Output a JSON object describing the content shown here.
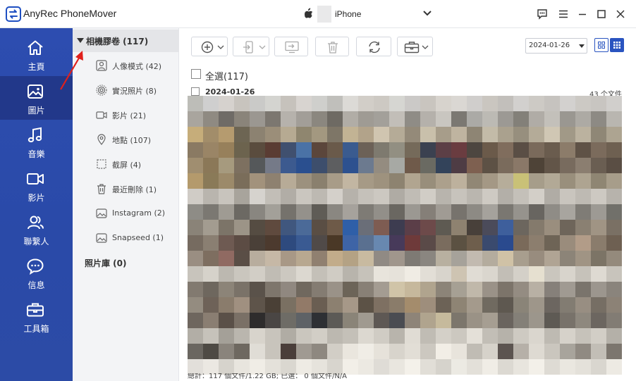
{
  "app": {
    "title": "AnyRec PhoneMover"
  },
  "device": {
    "name": "iPhone"
  },
  "nav": {
    "items": [
      {
        "label": "主頁",
        "icon": "home-icon"
      },
      {
        "label": "圖片",
        "icon": "image-icon",
        "active": true
      },
      {
        "label": "音樂",
        "icon": "music-icon"
      },
      {
        "label": "影片",
        "icon": "video-icon"
      },
      {
        "label": "聯繫人",
        "icon": "contacts-icon"
      },
      {
        "label": "信息",
        "icon": "message-icon"
      },
      {
        "label": "工具箱",
        "icon": "toolbox-icon"
      }
    ]
  },
  "albums": {
    "header": "相機膠卷 (117)",
    "items": [
      {
        "label": "人像模式 (42)",
        "icon": "portrait-icon"
      },
      {
        "label": "實況照片 (8)",
        "icon": "live-photo-icon"
      },
      {
        "label": "影片 (21)",
        "icon": "video-icon"
      },
      {
        "label": "地點 (107)",
        "icon": "location-icon"
      },
      {
        "label": "截屏 (4)",
        "icon": "screenshot-icon"
      },
      {
        "label": "最近刪除 (1)",
        "icon": "trash-icon"
      },
      {
        "label": "Instagram (2)",
        "icon": "album-icon"
      },
      {
        "label": "Snapseed (1)",
        "icon": "album-icon"
      }
    ],
    "library": "照片庫 (0)"
  },
  "toolbar": {
    "buttons": [
      "add-button",
      "export-device-button",
      "export-pc-button",
      "delete-button",
      "sync-button",
      "toolbox-button"
    ]
  },
  "filter": {
    "date": "2024-01-26"
  },
  "content": {
    "select_all": "全選(117)",
    "group_date": "2024-01-26",
    "group_count": "43 个文件",
    "thumbnail_colors": [
      "#bdbdb8",
      "#cfcfcf",
      "#d6d2ce",
      "#c8c4be",
      "#cacac8",
      "#d4d4d0",
      "#c6c2bc",
      "#d8d4d0",
      "#cfcfcc",
      "#c0bfbb",
      "#dcdad6",
      "#d2cec8",
      "#cdc9c3",
      "#d6d6d2",
      "#cbc9c7",
      "#c9c5bf",
      "#d7d3cd",
      "#dad7d3",
      "#d0cecc",
      "#cac6c0",
      "#c2bfbb",
      "#d2d0ce",
      "#cdcac5",
      "#c6c3bf",
      "#d3d1cf",
      "#ccc9c4",
      "#c8c5c1",
      "#d1cfcc",
      "#a9a59e",
      "#8f8a82",
      "#6f6b66",
      "#8a847a",
      "#9b9791",
      "#7c7770",
      "#b6b2ac",
      "#a29e98",
      "#8b877f",
      "#6e6a63",
      "#b1ada6",
      "#9f9b94",
      "#a3a09a",
      "#c2beb8",
      "#8f8c86",
      "#b5b1ab",
      "#c9c6c0",
      "#7b7872",
      "#abaaa6",
      "#bcbab4",
      "#9c9994",
      "#838079",
      "#b0aca6",
      "#c3c0ba",
      "#9a9791",
      "#adaaa4",
      "#8d8a84",
      "#b9b6b0",
      "#c6ad7a",
      "#a28d6a",
      "#b59b6f",
      "#6d6553",
      "#8c8271",
      "#9b8e79",
      "#b6aa92",
      "#8f866f",
      "#a39880",
      "#7e7667",
      "#c2b394",
      "#b2a38a",
      "#d0c5b0",
      "#b5ab97",
      "#948a79",
      "#c9c0ab",
      "#a79d8a",
      "#bfb4a0",
      "#8e8574",
      "#c3bba8",
      "#aaa18e",
      "#978f7e",
      "#b4ab98",
      "#d0c7b4",
      "#a19987",
      "#bbb29f",
      "#8f8776",
      "#ada491",
      "#8a7a63",
      "#9a8566",
      "#97805b",
      "#6c634e",
      "#5a4c3e",
      "#5a3c33",
      "#40506f",
      "#4a72a6",
      "#5b463b",
      "#6a5a4a",
      "#3a5b8f",
      "#6c6157",
      "#7e7a6f",
      "#928f82",
      "#756a5a",
      "#3b4150",
      "#5c3f46",
      "#6a3c40",
      "#4d4640",
      "#6b5a4a",
      "#806d5d",
      "#5a4e45",
      "#7a6a5b",
      "#6a5c4e",
      "#8c7c6a",
      "#5f5246",
      "#7b6b5c",
      "#6e6051",
      "#a08e70",
      "#8b7858",
      "#a69a7e",
      "#7d7060",
      "#55585a",
      "#757a88",
      "#3c5a8f",
      "#2a4f8f",
      "#3d4e6c",
      "#5d5e60",
      "#2d518f",
      "#6c7a8f",
      "#948c80",
      "#a7a9a4",
      "#6f5a4a",
      "#6a6a62",
      "#33435a",
      "#4e3c44",
      "#7e6050",
      "#5d5145",
      "#7a6b5c",
      "#8a7868",
      "#4e4337",
      "#625548",
      "#786b5e",
      "#8b7e70",
      "#6a5e52",
      "#5a4e44",
      "#b49a6c",
      "#8a7a58",
      "#9c8a6a",
      "#7a6d5a",
      "#a2927c",
      "#8e8170",
      "#b7ab97",
      "#9c917e",
      "#8a806e",
      "#a89c88",
      "#c2b6a2",
      "#a69a86",
      "#9e927e",
      "#8d8370",
      "#b1a590",
      "#988e7b",
      "#aca08c",
      "#bdb19d",
      "#918775",
      "#a49885",
      "#b6ad9a",
      "#c9c177",
      "#a69d8a",
      "#b2a996",
      "#998f7c",
      "#aea491",
      "#8f8673",
      "#a79d8a",
      "#d0ccc6",
      "#b9b5ae",
      "#c8c4bd",
      "#a8a49c",
      "#d6d3ce",
      "#c2beb7",
      "#b1ada6",
      "#cac6bf",
      "#bdb9b2",
      "#d4d0ca",
      "#b6b2ab",
      "#c5c1ba",
      "#ccc8c1",
      "#afaba4",
      "#c0bcb5",
      "#d1cdc6",
      "#b8b4ad",
      "#c7c3bc",
      "#bab6af",
      "#cecac3",
      "#b3afa8",
      "#c4c0b9",
      "#d3cfc8",
      "#b0aca5",
      "#c9c5be",
      "#bebab3",
      "#cdc9c2",
      "#b7b3ac",
      "#8e8c86",
      "#7b7872",
      "#9f9b93",
      "#6c6963",
      "#898680",
      "#a3a099",
      "#75726c",
      "#94918b",
      "#5f5c56",
      "#8a8781",
      "#a6a29c",
      "#7e7b75",
      "#928f89",
      "#6a6761",
      "#9b9892",
      "#857f78",
      "#a09b94",
      "#77736d",
      "#8d8a84",
      "#a5a29c",
      "#7a7771",
      "#96938d",
      "#686560",
      "#8f8c86",
      "#a8a59f",
      "#7f7c76",
      "#9d9a94",
      "#71706a",
      "#8a8378",
      "#a39c90",
      "#7c7468",
      "#9c9487",
      "#554c42",
      "#5f4a3e",
      "#40577e",
      "#4b6a98",
      "#5a4e44",
      "#6e5a48",
      "#2f5fa8",
      "#6a6e78",
      "#7e5c52",
      "#3d3c50",
      "#5b3e48",
      "#6d4a4a",
      "#5e5a52",
      "#8e8270",
      "#48403a",
      "#4b4b5a",
      "#3e5f9c",
      "#6c665e",
      "#847a6c",
      "#9a8e7e",
      "#6e655a",
      "#8a8072",
      "#a09484",
      "#7a7064",
      "#766b60",
      "#8a7f72",
      "#6e5a52",
      "#5c4c44",
      "#4a4038",
      "#4c3a2e",
      "#2e4a7e",
      "#3a5a92",
      "#504a48",
      "#4a3826",
      "#3e64a6",
      "#5a7090",
      "#6888b0",
      "#473a5a",
      "#6e3a3a",
      "#5a4a48",
      "#7a6c5e",
      "#5b5142",
      "#6e5e4c",
      "#3a4a6e",
      "#2a4a8e",
      "#7a6a5a",
      "#8c7e6e",
      "#6e6456",
      "#9a8c7c",
      "#b29c88",
      "#8a7c6c",
      "#6e6052",
      "#9a8e82",
      "#7e6e60",
      "#906a62",
      "#5a4e46",
      "#b8ad9e",
      "#c6b8a6",
      "#a89886",
      "#b8a890",
      "#908070",
      "#c2ac8a",
      "#b4a284",
      "#c8baa0",
      "#908a84",
      "#a0968c",
      "#7e7a74",
      "#8a8680",
      "#b8b0a0",
      "#a6a29a",
      "#c2bab0",
      "#b4ac9e",
      "#d0c2a6",
      "#a89e8e",
      "#988c7e",
      "#b0a494",
      "#8c8478",
      "#a09484",
      "#7c7466",
      "#948a7c",
      "#c8c4bc",
      "#d6d2ca",
      "#bcb8b0",
      "#cac6be",
      "#d2cec6",
      "#c0bcb4",
      "#ccc8c0",
      "#dcd8d0",
      "#c4c0b8",
      "#d0ccc4",
      "#b8b4ac",
      "#c6c2ba",
      "#e8e4dc",
      "#e6e2da",
      "#f0ece4",
      "#e2ded6",
      "#d8d4cc",
      "#cec4b2",
      "#e0dcd4",
      "#dad6ce",
      "#c2beb6",
      "#d4d0c8",
      "#e6e0d0",
      "#cac6be",
      "#d8d4cc",
      "#c6c2ba",
      "#dedad2",
      "#c8c4bc",
      "#827a70",
      "#6e675e",
      "#8c8478",
      "#7a7268",
      "#5a524a",
      "#7e766c",
      "#908880",
      "#70685e",
      "#847c72",
      "#9a9288",
      "#6c6458",
      "#888076",
      "#a49c92",
      "#d0c4a8",
      "#c6b89c",
      "#b0a48e",
      "#8c8478",
      "#a6a094",
      "#c0b8aa",
      "#9a9288",
      "#7c746a",
      "#948c82",
      "#b8b0a4",
      "#86807a",
      "#a09a92",
      "#7a746c",
      "#9c968e",
      "#8a847c",
      "#948c80",
      "#6e6258",
      "#8a7c6c",
      "#a09080",
      "#5e544a",
      "#4a4036",
      "#7a7062",
      "#927a68",
      "#6a5e52",
      "#8c8070",
      "#a69888",
      "#5c5246",
      "#7e7062",
      "#8a7c6a",
      "#a48c6c",
      "#9e8e7c",
      "#6c6256",
      "#8e8474",
      "#a49a8c",
      "#706a60",
      "#5e5850",
      "#8a8478",
      "#9e968a",
      "#6c6660",
      "#827c72",
      "#988e82",
      "#766e64",
      "#8c8276",
      "#6e665e",
      "#8a7e72",
      "#5a5048",
      "#7a7066",
      "#2e2c2c",
      "#4a4644",
      "#6e6c66",
      "#5e6266",
      "#2e3034",
      "#5c5a56",
      "#8a8478",
      "#a09a90",
      "#5e5854",
      "#4a4c52",
      "#8e8478",
      "#b0a48e",
      "#c6ba9c",
      "#7c766c",
      "#9a9286",
      "#a69e92",
      "#6a645e",
      "#848078",
      "#9c968c",
      "#5e5a54",
      "#78726a",
      "#8e887e",
      "#6c6660",
      "#827c74",
      "#b2aea6",
      "#c6c2ba",
      "#a4a098",
      "#bab6ae",
      "#d8d4cc",
      "#c8c4bc",
      "#b0aca4",
      "#cac6be",
      "#d2cec6",
      "#bcb8b0",
      "#c4c0b8",
      "#dcd8d0",
      "#d0ccc4",
      "#b8b4ac",
      "#e0dcd4",
      "#c0bcb4",
      "#d4d0c8",
      "#ccc8c0",
      "#e4e0d8",
      "#c2beb6",
      "#b6b2aa",
      "#cecac2",
      "#dad6ce",
      "#bebab2",
      "#d6d2ca",
      "#c6c2ba",
      "#d2cec6",
      "#b4b0a8",
      "#6a6660",
      "#4e4a44",
      "#8a847c",
      "#6e6860",
      "#e0ddd6",
      "#c8c4bc",
      "#4a3e3a",
      "#a09a92",
      "#8e8880",
      "#d2cec6",
      "#eae6de",
      "#f0ede6",
      "#e6e2da",
      "#d8d4cc",
      "#e2ded6",
      "#ccc8c0",
      "#f2eee6",
      "#e8e4dc",
      "#c0bcb4",
      "#d6d2ca",
      "#5c5450",
      "#b6b0a8",
      "#dedad2",
      "#cac6be",
      "#a8a49c",
      "#908a82",
      "#c2beb6",
      "#7c766e",
      "#e2dfda",
      "#ebe8e2",
      "#d6d3cc",
      "#e8e5de",
      "#f0ede6",
      "#e4e1da",
      "#dad7d0",
      "#eeebe4",
      "#e6e3dc",
      "#d8d5ce",
      "#f2efe8",
      "#ece9e2",
      "#dfdcd6",
      "#e9e6df",
      "#f4f1ea",
      "#e1ded7",
      "#d6d3cc",
      "#eceae3",
      "#e3e0d9",
      "#f0ede6",
      "#dcd9d2",
      "#e8e5de",
      "#f3f0e9",
      "#dedbd4",
      "#eae7e0",
      "#e4e1da",
      "#d9d6cf",
      "#edeae3"
    ]
  },
  "status": {
    "text": "總計：117 個文件/1.22 GB; 已選： 0 個文件/N/A"
  }
}
